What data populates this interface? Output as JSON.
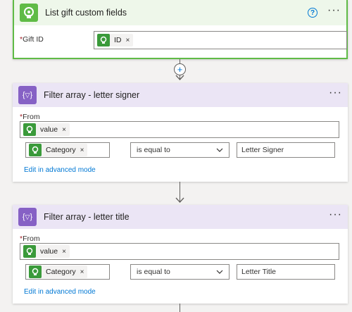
{
  "colors": {
    "trigger_accent": "#5fbb46",
    "filter_accent": "#8661c5",
    "token_green": "#3a9a3a",
    "link_blue": "#0078d4",
    "required_red": "#a4262c"
  },
  "step1": {
    "title": "List gift custom fields",
    "help_icon": "?",
    "more_icon": "···",
    "field_label": "Gift ID",
    "required_mark": "*",
    "token": {
      "label": "ID",
      "remove": "×"
    }
  },
  "connector1": {
    "add_icon": "+"
  },
  "step2": {
    "title": "Filter array - letter signer",
    "more_icon": "···",
    "from_label": "From",
    "required_mark": "*",
    "from_token": {
      "label": "value",
      "remove": "×"
    },
    "condition_token": {
      "label": "Category",
      "remove": "×"
    },
    "operator": "is equal to",
    "value": "Letter Signer",
    "advanced_link": "Edit in advanced mode"
  },
  "step3": {
    "title": "Filter array - letter title",
    "more_icon": "···",
    "from_label": "From",
    "required_mark": "*",
    "from_token": {
      "label": "value",
      "remove": "×"
    },
    "condition_token": {
      "label": "Category",
      "remove": "×"
    },
    "operator": "is equal to",
    "value": "Letter Title",
    "advanced_link": "Edit in advanced mode"
  }
}
